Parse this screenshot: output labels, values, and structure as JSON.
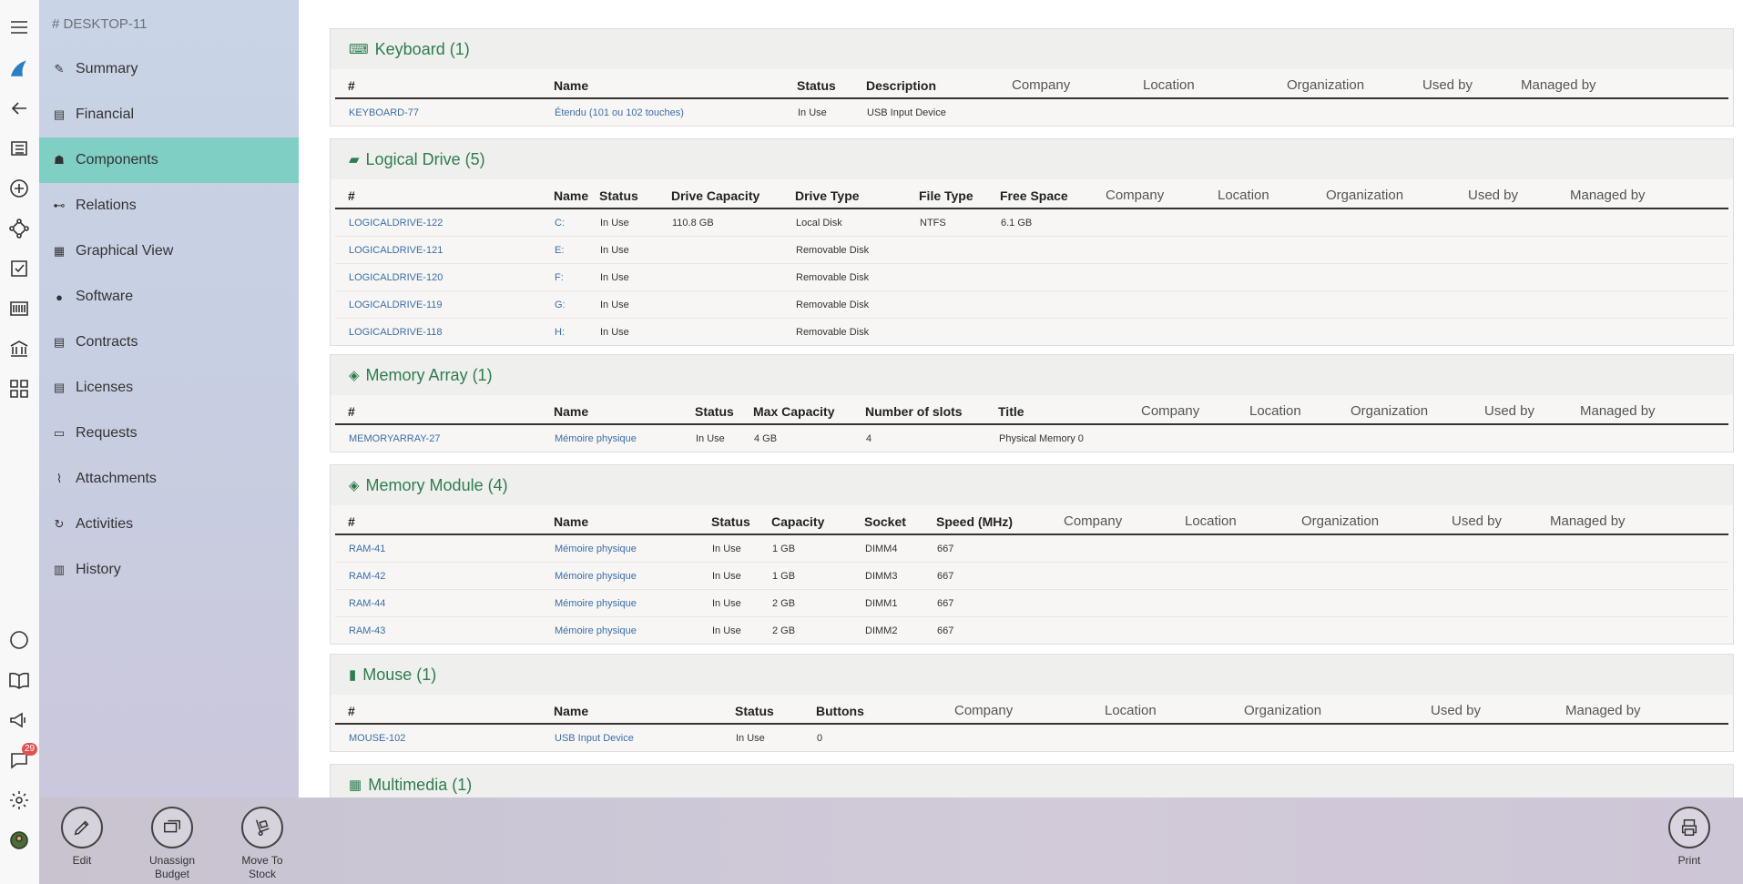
{
  "device": {
    "title": "# DESKTOP-11"
  },
  "nav": [
    {
      "label": "Summary",
      "icon": "summary-icon",
      "glyph": "✎"
    },
    {
      "label": "Financial",
      "icon": "financial-icon",
      "glyph": "▤"
    },
    {
      "label": "Components",
      "icon": "components-icon",
      "glyph": "☗",
      "active": true
    },
    {
      "label": "Relations",
      "icon": "relations-icon",
      "glyph": "⊷"
    },
    {
      "label": "Graphical View",
      "icon": "graphical-view-icon",
      "glyph": "▦"
    },
    {
      "label": "Software",
      "icon": "software-icon",
      "glyph": "●"
    },
    {
      "label": "Contracts",
      "icon": "contracts-icon",
      "glyph": "▤"
    },
    {
      "label": "Licenses",
      "icon": "licenses-icon",
      "glyph": "▤"
    },
    {
      "label": "Requests",
      "icon": "requests-icon",
      "glyph": "▭"
    },
    {
      "label": "Attachments",
      "icon": "attachments-icon",
      "glyph": "⌇"
    },
    {
      "label": "Activities",
      "icon": "activities-icon",
      "glyph": "↻"
    },
    {
      "label": "History",
      "icon": "history-icon",
      "glyph": "▥"
    }
  ],
  "rail": {
    "notification_count": "29"
  },
  "panels": {
    "keyboard": {
      "title": "Keyboard (1)",
      "headers": [
        "#",
        "Name",
        "Status",
        "Description",
        "Company",
        "Location",
        "Organization",
        "Used by",
        "Managed by"
      ],
      "rows": [
        [
          "KEYBOARD-77",
          "Étendu (101 ou 102 touches)",
          "In Use",
          "USB Input Device"
        ]
      ]
    },
    "logical_drive": {
      "title": "Logical Drive (5)",
      "headers": [
        "#",
        "Name",
        "Status",
        "Drive Capacity",
        "Drive Type",
        "File Type",
        "Free Space",
        "Company",
        "Location",
        "Organization",
        "Used by",
        "Managed by"
      ],
      "rows": [
        [
          "LOGICALDRIVE-122",
          "C:",
          "In Use",
          "110.8 GB",
          "Local Disk",
          "NTFS",
          "6.1 GB"
        ],
        [
          "LOGICALDRIVE-121",
          "E:",
          "In Use",
          "",
          "Removable Disk",
          "",
          ""
        ],
        [
          "LOGICALDRIVE-120",
          "F:",
          "In Use",
          "",
          "Removable Disk",
          "",
          ""
        ],
        [
          "LOGICALDRIVE-119",
          "G:",
          "In Use",
          "",
          "Removable Disk",
          "",
          ""
        ],
        [
          "LOGICALDRIVE-118",
          "H:",
          "In Use",
          "",
          "Removable Disk",
          "",
          ""
        ]
      ]
    },
    "memory_array": {
      "title": "Memory Array (1)",
      "headers": [
        "#",
        "Name",
        "Status",
        "Max Capacity",
        "Number of slots",
        "Title",
        "Company",
        "Location",
        "Organization",
        "Used by",
        "Managed by"
      ],
      "rows": [
        [
          "MEMORYARRAY-27",
          "Mémoire physique",
          "In Use",
          "4 GB",
          "4",
          "Physical Memory 0"
        ]
      ]
    },
    "memory_module": {
      "title": "Memory Module (4)",
      "headers": [
        "#",
        "Name",
        "Status",
        "Capacity",
        "Socket",
        "Speed (MHz)",
        "Company",
        "Location",
        "Organization",
        "Used by",
        "Managed by"
      ],
      "rows": [
        [
          "RAM-41",
          "Mémoire physique",
          "In Use",
          "1 GB",
          "DIMM4",
          "667"
        ],
        [
          "RAM-42",
          "Mémoire physique",
          "In Use",
          "1 GB",
          "DIMM3",
          "667"
        ],
        [
          "RAM-44",
          "Mémoire physique",
          "In Use",
          "2 GB",
          "DIMM1",
          "667"
        ],
        [
          "RAM-43",
          "Mémoire physique",
          "In Use",
          "2 GB",
          "DIMM2",
          "667"
        ]
      ]
    },
    "mouse": {
      "title": "Mouse (1)",
      "headers": [
        "#",
        "Name",
        "Status",
        "Buttons",
        "Company",
        "Location",
        "Organization",
        "Used by",
        "Managed by"
      ],
      "rows": [
        [
          "MOUSE-102",
          "USB Input Device",
          "In Use",
          "0"
        ]
      ]
    },
    "multimedia": {
      "title": "Multimedia (1)"
    }
  },
  "toolbar": {
    "edit_label": "Edit",
    "unassign_label_1": "Unassign",
    "unassign_label_2": "Budget",
    "move_label_1": "Move To",
    "move_label_2": "Stock",
    "print_label": "Print"
  },
  "colors": {
    "accent": "#2e7d4f",
    "active_nav": "#7fcfc5",
    "link": "#3a6ea8"
  }
}
